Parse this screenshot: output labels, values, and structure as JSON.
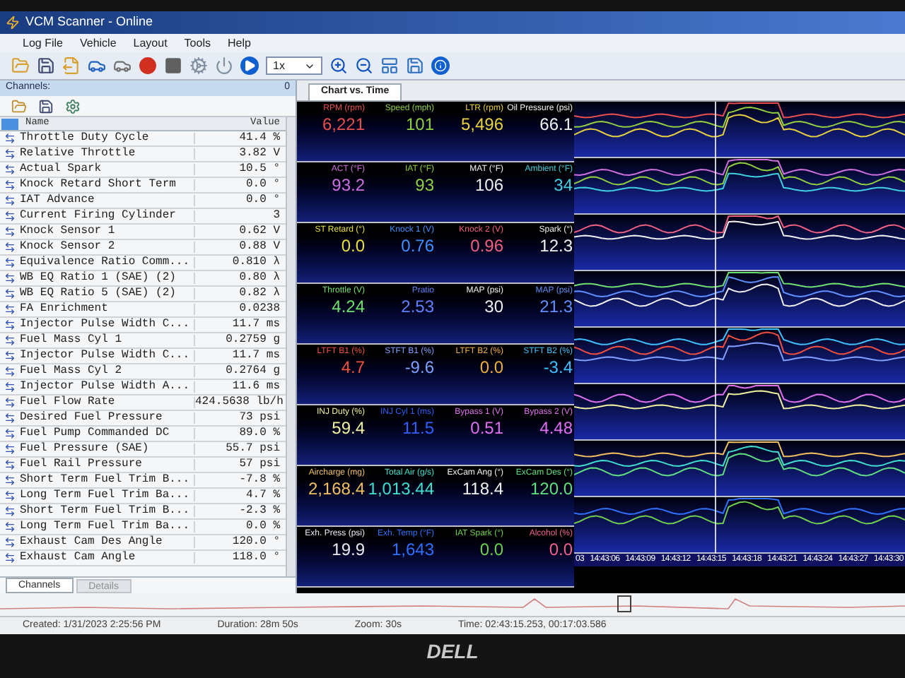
{
  "window": {
    "title": "VCM Scanner - Online"
  },
  "menu": [
    "Log File",
    "Vehicle",
    "Layout",
    "Tools",
    "Help"
  ],
  "toolbar": {
    "speed": "1x"
  },
  "channels_panel": {
    "title": "Channels:",
    "count": "0",
    "columns": [
      "Name",
      "Value"
    ],
    "rows": [
      {
        "name": "Throttle Duty Cycle",
        "value": "41.4 %"
      },
      {
        "name": "Relative Throttle",
        "value": "3.82 V"
      },
      {
        "name": "Actual Spark",
        "value": "10.5 °"
      },
      {
        "name": "Knock Retard Short Term",
        "value": "0.0 °"
      },
      {
        "name": "IAT Advance",
        "value": "0.0 °"
      },
      {
        "name": "Current Firing Cylinder",
        "value": "3"
      },
      {
        "name": "Knock Sensor 1",
        "value": "0.62 V"
      },
      {
        "name": "Knock Sensor 2",
        "value": "0.88 V"
      },
      {
        "name": "Equivalence Ratio Comm...",
        "value": "0.810 λ"
      },
      {
        "name": "WB EQ Ratio 1 (SAE) (2)",
        "value": "0.80 λ"
      },
      {
        "name": "WB EQ Ratio 5 (SAE) (2)",
        "value": "0.82 λ"
      },
      {
        "name": "FA Enrichment",
        "value": "0.0238"
      },
      {
        "name": "Injector Pulse Width C...",
        "value": "11.7 ms"
      },
      {
        "name": "Fuel Mass Cyl 1",
        "value": "0.2759 g"
      },
      {
        "name": "Injector Pulse Width C...",
        "value": "11.7 ms"
      },
      {
        "name": "Fuel Mass Cyl 2",
        "value": "0.2764 g"
      },
      {
        "name": "Injector Pulse Width A...",
        "value": "11.6 ms"
      },
      {
        "name": "Fuel Flow Rate",
        "value": "424.5638 lb/h"
      },
      {
        "name": "Desired Fuel Pressure",
        "value": "73 psi"
      },
      {
        "name": "Fuel Pump Commanded DC",
        "value": "89.0 %"
      },
      {
        "name": "Fuel Pressure (SAE)",
        "value": "55.7 psi"
      },
      {
        "name": "Fuel Rail Pressure",
        "value": "57 psi"
      },
      {
        "name": "Short Term Fuel Trim B...",
        "value": "-7.8 %"
      },
      {
        "name": "Long Term Fuel Trim Ba...",
        "value": "4.7 %"
      },
      {
        "name": "Short Term Fuel Trim B...",
        "value": "-2.3 %"
      },
      {
        "name": "Long Term Fuel Trim Ba...",
        "value": "0.0 %"
      },
      {
        "name": "Exhaust Cam Des Angle",
        "value": "120.0 °"
      },
      {
        "name": "Exhaust Cam Angle",
        "value": "118.0 °"
      }
    ],
    "tabs": [
      {
        "label": "Channels",
        "selected": true
      },
      {
        "label": "Details",
        "selected": false
      }
    ]
  },
  "chart_tabs": [
    {
      "label": "Chart vs. Time",
      "selected": true
    }
  ],
  "gauge_rows": [
    {
      "gauges": [
        {
          "label": "RPM (rpm)",
          "value": "6,221",
          "color": "#e85050"
        },
        {
          "label": "Speed (mph)",
          "value": "101",
          "color": "#90d040"
        },
        {
          "label": "LTR (rpm)",
          "value": "5,496",
          "color": "#e8d040"
        },
        {
          "label": "Oil Pressure (psi)",
          "value": "66.1",
          "color": "#f0f0f0"
        }
      ]
    },
    {
      "gauges": [
        {
          "label": "ACT (°F)",
          "value": "93.2",
          "color": "#d070e0"
        },
        {
          "label": "IAT (°F)",
          "value": "93",
          "color": "#90d040"
        },
        {
          "label": "MAT (°F)",
          "value": "106",
          "color": "#f0f0f0"
        },
        {
          "label": "Ambient (°F)",
          "value": "34",
          "color": "#40d0e0"
        }
      ]
    },
    {
      "gauges": [
        {
          "label": "ST Retard (°)",
          "value": "0.0",
          "color": "#e8e040"
        },
        {
          "label": "Knock 1 (V)",
          "value": "0.76",
          "color": "#4090ff"
        },
        {
          "label": "Knock 2 (V)",
          "value": "0.96",
          "color": "#f06080"
        },
        {
          "label": "Spark (°)",
          "value": "12.3",
          "color": "#f0f0f0"
        }
      ]
    },
    {
      "gauges": [
        {
          "label": "Throttle (V)",
          "value": "4.24",
          "color": "#70e070"
        },
        {
          "label": "Pratio",
          "value": "2.53",
          "color": "#6080ff"
        },
        {
          "label": "MAP (psi)",
          "value": "30",
          "color": "#f0f0f0"
        },
        {
          "label": "MAP (psi)",
          "value": "21.3",
          "color": "#6090ff"
        }
      ]
    },
    {
      "gauges": [
        {
          "label": "LTFT B1 (%)",
          "value": "4.7",
          "color": "#f05040"
        },
        {
          "label": "STFT B1 (%)",
          "value": "-9.6",
          "color": "#80a0ff"
        },
        {
          "label": "LTFT B2 (%)",
          "value": "0.0",
          "color": "#f0b040"
        },
        {
          "label": "STFT B2 (%)",
          "value": "-3.4",
          "color": "#40c0ff"
        }
      ]
    },
    {
      "gauges": [
        {
          "label": "INJ Duty (%)",
          "value": "59.4",
          "color": "#f0f0a0"
        },
        {
          "label": "INJ Cyl 1 (ms)",
          "value": "11.5",
          "color": "#3060ff"
        },
        {
          "label": "Bypass 1 (V)",
          "value": "0.51",
          "color": "#e070f0"
        },
        {
          "label": "Bypass 2 (V)",
          "value": "4.48",
          "color": "#e070f0"
        }
      ]
    },
    {
      "gauges": [
        {
          "label": "Aircharge (mg)",
          "value": "2,168.4",
          "color": "#f0c060"
        },
        {
          "label": "Total Air (g/s)",
          "value": "1,013.44",
          "color": "#40e0d0"
        },
        {
          "label": "ExCam Ang (°)",
          "value": "118.4",
          "color": "#f0f0f0"
        },
        {
          "label": "ExCam Des (°)",
          "value": "120.0",
          "color": "#60e080"
        }
      ]
    },
    {
      "gauges": [
        {
          "label": "Exh. Press (psi)",
          "value": "19.9",
          "color": "#e8e8f0"
        },
        {
          "label": "Exh. Temp (°F)",
          "value": "1,643",
          "color": "#3070ff"
        },
        {
          "label": "IAT Spark (°)",
          "value": "0.0",
          "color": "#70d050"
        },
        {
          "label": "Alcohol (%)",
          "value": "0.0",
          "color": "#f06090"
        }
      ]
    }
  ],
  "time_axis": [
    "03",
    "14:43:06",
    "14:43:09",
    "14:43:12",
    "14:43:15",
    "14:43:18",
    "14:43:21",
    "14:43:24",
    "14:43:27",
    "14:43:30"
  ],
  "status_bar": {
    "created": "Created: 1/31/2023 2:25:56 PM",
    "duration": "Duration: 28m 50s",
    "zoom": "Zoom: 30s",
    "time": "Time: 02:43:15.253, 00:17:03.586"
  },
  "bezel_logo": "DELL"
}
